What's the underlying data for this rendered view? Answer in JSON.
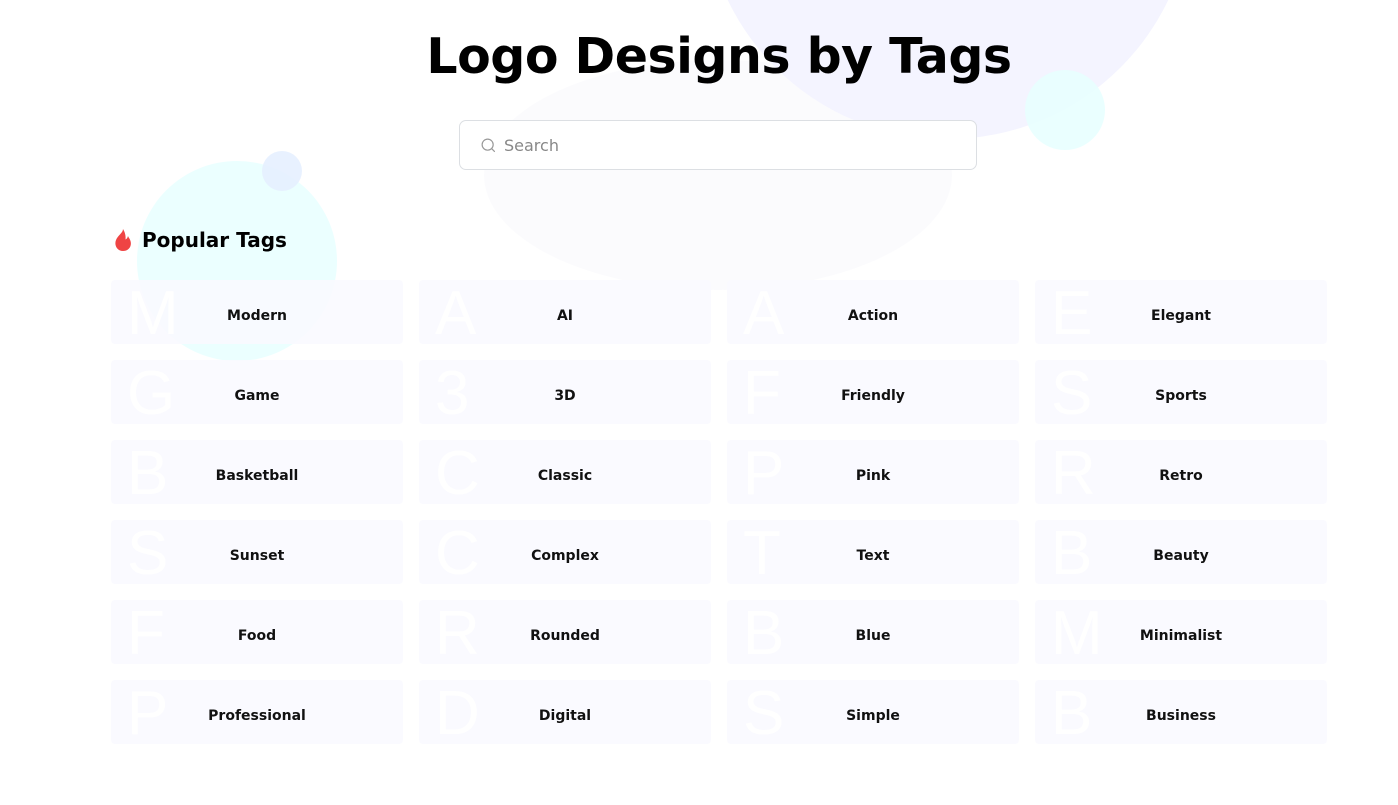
{
  "header": {
    "title": "Logo Designs by Tags"
  },
  "search": {
    "placeholder": "Search",
    "value": "",
    "icon": "search-icon"
  },
  "section": {
    "icon": "fire-icon",
    "title": "Popular Tags",
    "icon_color": "#ef4444"
  },
  "tags": [
    {
      "letter": "M",
      "label": "Modern"
    },
    {
      "letter": "A",
      "label": "AI"
    },
    {
      "letter": "A",
      "label": "Action"
    },
    {
      "letter": "E",
      "label": "Elegant"
    },
    {
      "letter": "G",
      "label": "Game"
    },
    {
      "letter": "3",
      "label": "3D"
    },
    {
      "letter": "F",
      "label": "Friendly"
    },
    {
      "letter": "S",
      "label": "Sports"
    },
    {
      "letter": "B",
      "label": "Basketball"
    },
    {
      "letter": "C",
      "label": "Classic"
    },
    {
      "letter": "P",
      "label": "Pink"
    },
    {
      "letter": "R",
      "label": "Retro"
    },
    {
      "letter": "S",
      "label": "Sunset"
    },
    {
      "letter": "C",
      "label": "Complex"
    },
    {
      "letter": "T",
      "label": "Text"
    },
    {
      "letter": "B",
      "label": "Beauty"
    },
    {
      "letter": "F",
      "label": "Food"
    },
    {
      "letter": "R",
      "label": "Rounded"
    },
    {
      "letter": "B",
      "label": "Blue"
    },
    {
      "letter": "M",
      "label": "Minimalist"
    },
    {
      "letter": "P",
      "label": "Professional"
    },
    {
      "letter": "D",
      "label": "Digital"
    },
    {
      "letter": "S",
      "label": "Simple"
    },
    {
      "letter": "B",
      "label": "Business"
    }
  ]
}
